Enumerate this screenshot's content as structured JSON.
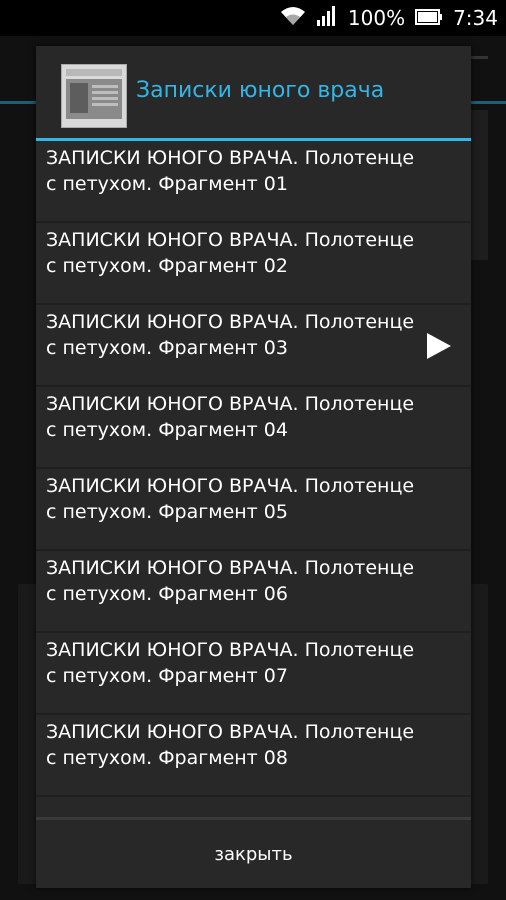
{
  "status_bar": {
    "battery_percent": "100%",
    "time": "7:34",
    "icons": [
      "wifi-icon",
      "signal-icon",
      "battery-icon"
    ]
  },
  "dialog": {
    "title": "Записки юного врача",
    "thumbnail": "book-cover-thumbnail",
    "items": [
      {
        "text": "ЗАПИСКИ ЮНОГО ВРАЧА. Полотенце с петухом. Фрагмент 01"
      },
      {
        "text": "ЗАПИСКИ ЮНОГО ВРАЧА. Полотенце с петухом. Фрагмент 02"
      },
      {
        "text": "ЗАПИСКИ ЮНОГО ВРАЧА. Полотенце с петухом. Фрагмент 03"
      },
      {
        "text": "ЗАПИСКИ ЮНОГО ВРАЧА. Полотенце с петухом. Фрагмент 04"
      },
      {
        "text": "ЗАПИСКИ ЮНОГО ВРАЧА. Полотенце с петухом. Фрагмент 05"
      },
      {
        "text": "ЗАПИСКИ ЮНОГО ВРАЧА. Полотенце с петухом. Фрагмент 06"
      },
      {
        "text": "ЗАПИСКИ ЮНОГО ВРАЧА. Полотенце с петухом. Фрагмент 07"
      },
      {
        "text": "ЗАПИСКИ ЮНОГО ВРАЧА. Полотенце с петухом. Фрагмент 08"
      }
    ],
    "playing_index": 2,
    "close_label": "закрыть"
  },
  "colors": {
    "accent": "#33b5e5",
    "dialog_bg": "#282828"
  }
}
